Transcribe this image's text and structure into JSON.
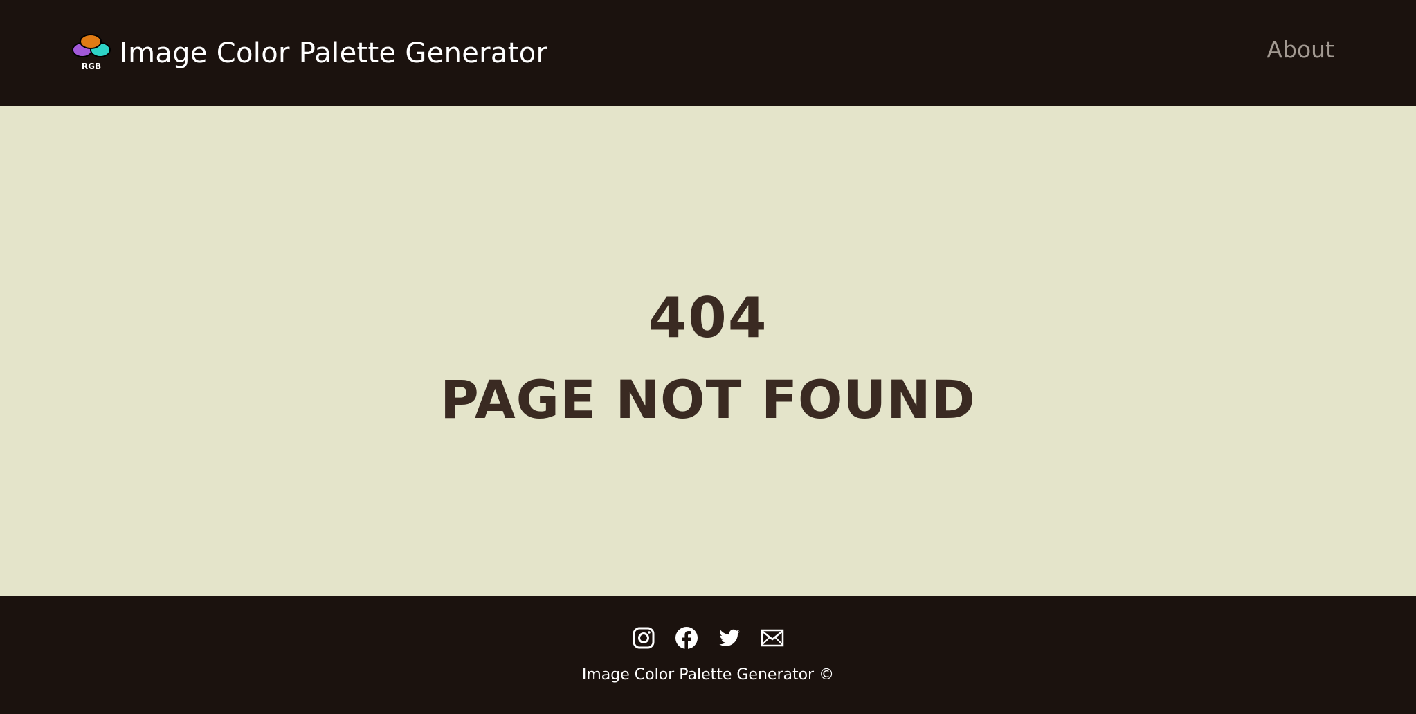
{
  "header": {
    "title": "Image Color Palette Generator",
    "logo_text": "RGB",
    "nav": {
      "about_label": "About"
    }
  },
  "main": {
    "error_code": "404",
    "error_message": "PAGE NOT FOUND"
  },
  "footer": {
    "social_icons": [
      "instagram-icon",
      "facebook-icon",
      "twitter-icon",
      "mail-icon"
    ],
    "copyright": "Image Color Palette Generator ©"
  },
  "colors": {
    "header_bg": "#1b120e",
    "main_bg": "#e4e4ca",
    "heading_text": "#3a2a22",
    "nav_text": "#a39a92",
    "logo_orange": "#e07b14",
    "logo_purple": "#a259d9",
    "logo_cyan": "#2ed3c6"
  }
}
